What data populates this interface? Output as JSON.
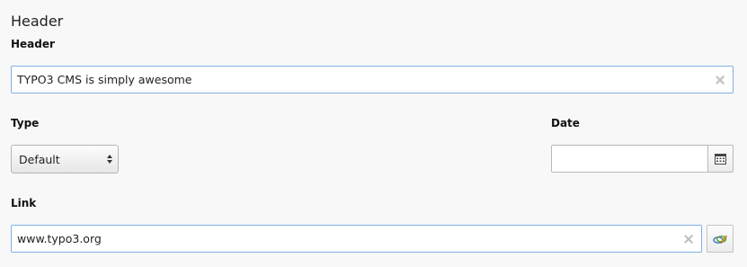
{
  "section": {
    "title": "Header"
  },
  "header_field": {
    "label": "Header",
    "value": "TYPO3 CMS is simply awesome"
  },
  "type_field": {
    "label": "Type",
    "selected": "Default"
  },
  "date_field": {
    "label": "Date",
    "value": ""
  },
  "link_field": {
    "label": "Link",
    "value": "www.typo3.org"
  },
  "icons": {
    "clear": "close-icon",
    "select": "chevron-updown-icon",
    "calendar": "calendar-icon",
    "link_wizard": "link-wizard-icon"
  },
  "colors": {
    "focus_border": "#7fb2e5",
    "background": "#f8f8f8"
  }
}
